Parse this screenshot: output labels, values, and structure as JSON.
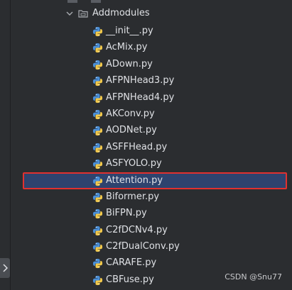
{
  "project_tree": {
    "folder": {
      "label": "Addmodules",
      "expanded": true,
      "icon": "folder-icon"
    },
    "files": [
      {
        "label": "__init__.py",
        "icon": "python-file-icon"
      },
      {
        "label": "AcMix.py",
        "icon": "python-file-icon"
      },
      {
        "label": "ADown.py",
        "icon": "python-file-icon"
      },
      {
        "label": "AFPNHead3.py",
        "icon": "python-file-icon"
      },
      {
        "label": "AFPNHead4.py",
        "icon": "python-file-icon"
      },
      {
        "label": "AKConv.py",
        "icon": "python-file-icon"
      },
      {
        "label": "AODNet.py",
        "icon": "python-file-icon"
      },
      {
        "label": "ASFFHead.py",
        "icon": "python-file-icon"
      },
      {
        "label": "ASFYOLO.py",
        "icon": "python-file-icon"
      },
      {
        "label": "Attention.py",
        "icon": "python-file-icon",
        "selected": true
      },
      {
        "label": "Biformer.py",
        "icon": "python-file-icon"
      },
      {
        "label": "BiFPN.py",
        "icon": "python-file-icon"
      },
      {
        "label": "C2fDCNv4.py",
        "icon": "python-file-icon"
      },
      {
        "label": "C2fDualConv.py",
        "icon": "python-file-icon"
      },
      {
        "label": "CARAFE.py",
        "icon": "python-file-icon"
      },
      {
        "label": "CBFuse.py",
        "icon": "python-file-icon"
      }
    ]
  },
  "watermark": "CSDN @Snu77",
  "colors": {
    "background": "#2b2d30",
    "selection": "#2e436e",
    "highlight_border": "#e0312f",
    "python_blue": "#4a8fd8",
    "python_yellow": "#f2c94c"
  }
}
